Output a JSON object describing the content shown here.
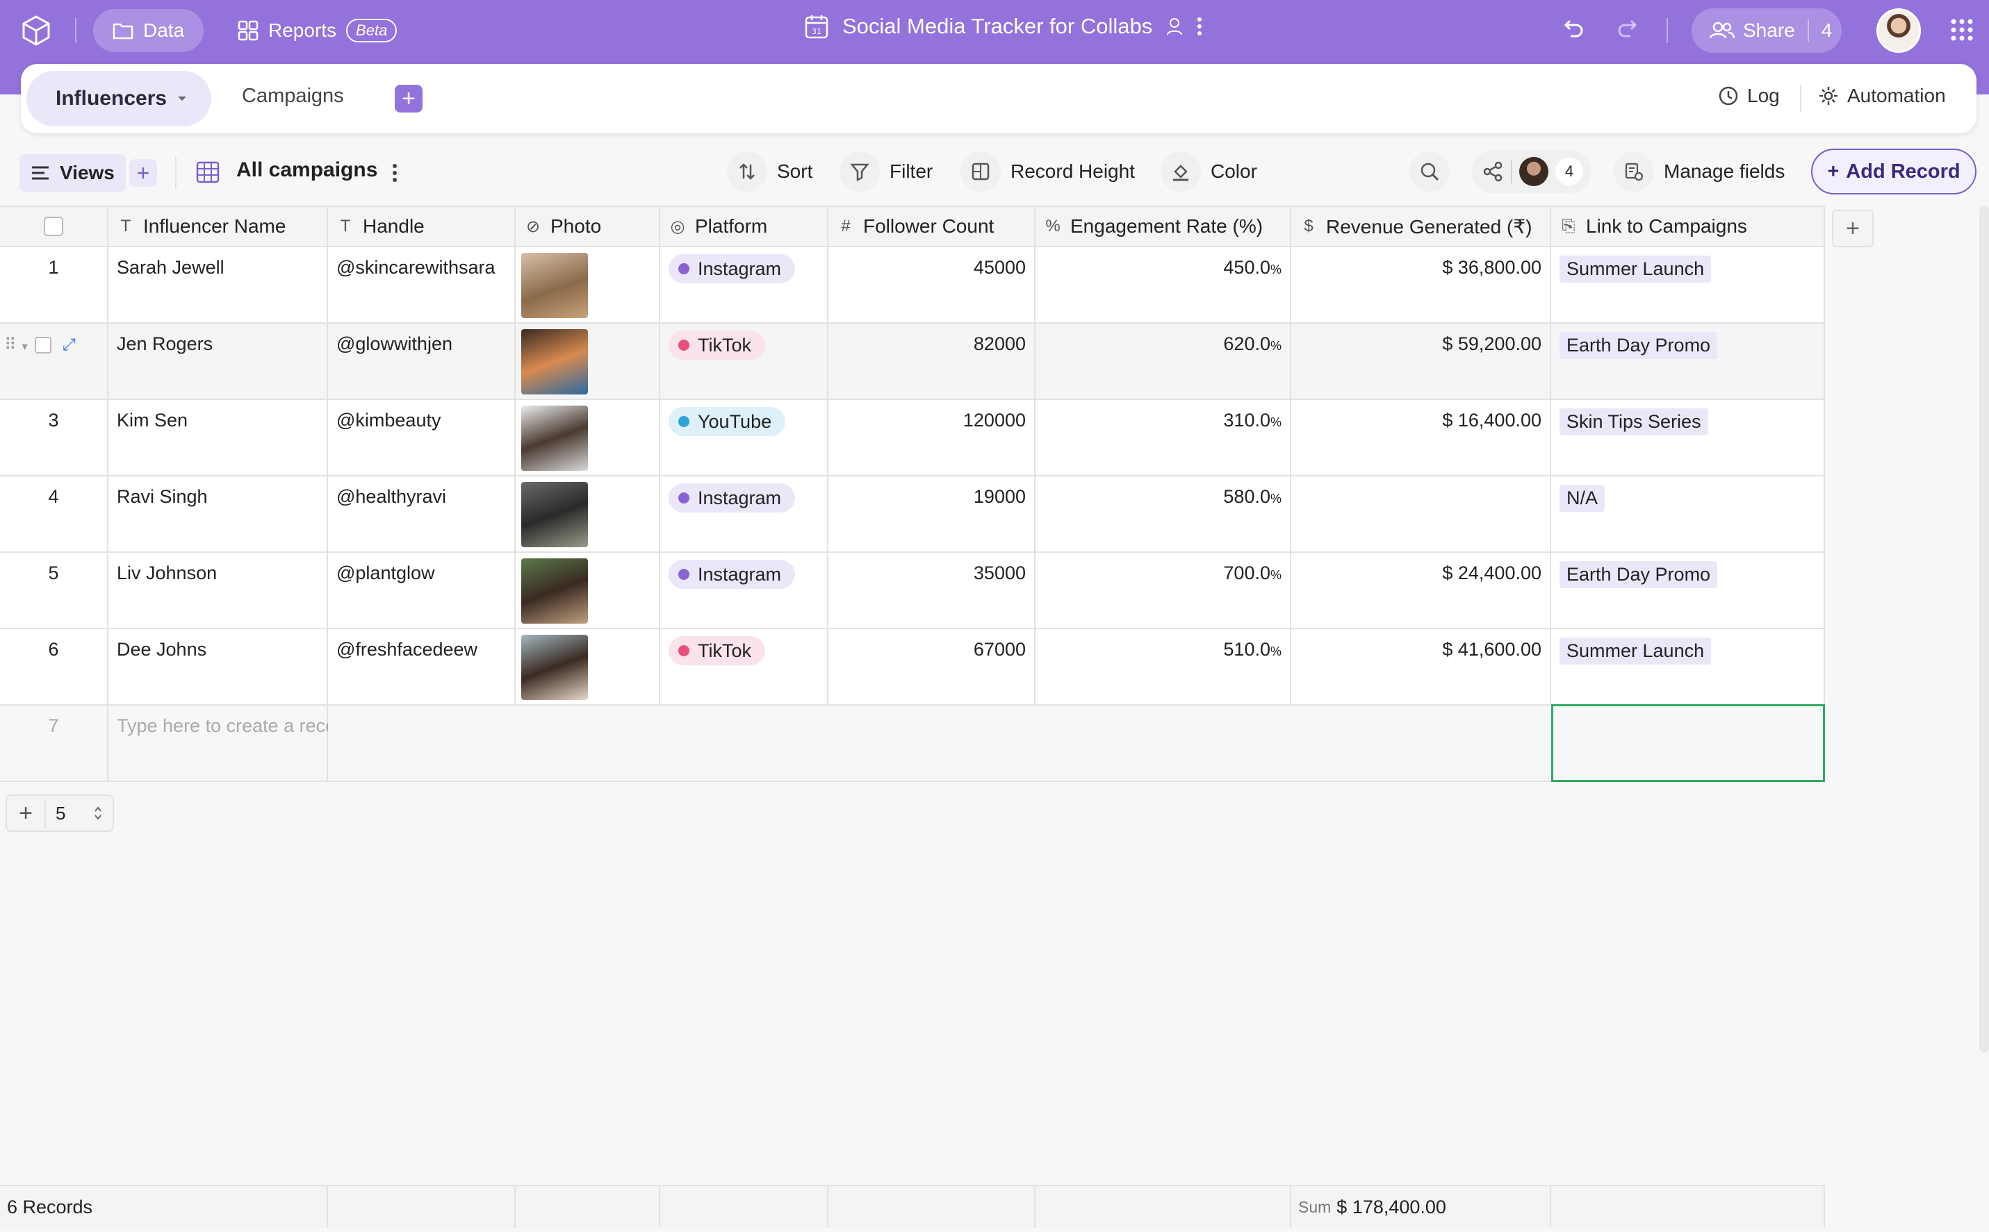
{
  "topbar": {
    "data_tab": "Data",
    "reports_tab": "Reports",
    "reports_badge": "Beta",
    "title": "Social Media Tracker for Collabs",
    "share_label": "Share",
    "share_count": "4"
  },
  "tabs": {
    "active": "Influencers",
    "other": "Campaigns",
    "log": "Log",
    "automation": "Automation"
  },
  "toolbar": {
    "views": "Views",
    "view_name": "All campaigns",
    "sort": "Sort",
    "filter": "Filter",
    "record_height": "Record Height",
    "color": "Color",
    "collaborators_count": "4",
    "manage_fields": "Manage fields",
    "add_record": "Add Record"
  },
  "columns": [
    {
      "label": "Influencer Name",
      "icon": "text-field-icon"
    },
    {
      "label": "Handle",
      "icon": "text-field-icon"
    },
    {
      "label": "Photo",
      "icon": "attachment-icon"
    },
    {
      "label": "Platform",
      "icon": "single-select-icon"
    },
    {
      "label": "Follower Count",
      "icon": "number-icon"
    },
    {
      "label": "Engagement Rate (%)",
      "icon": "percent-icon"
    },
    {
      "label": "Revenue Generated (₹)",
      "icon": "currency-icon"
    },
    {
      "label": "Link to Campaigns",
      "icon": "link-icon"
    }
  ],
  "rows": [
    {
      "idx": "1",
      "name": "Sarah Jewell",
      "handle": "@skincarewithsara",
      "platform": "Instagram",
      "followers": "45000",
      "engagement": "450.0",
      "revenue": "$ 36,800.00",
      "campaign": "Summer Launch"
    },
    {
      "idx": "2",
      "name": "Jen Rogers",
      "handle": "@glowwithjen",
      "platform": "TikTok",
      "followers": "82000",
      "engagement": "620.0",
      "revenue": "$ 59,200.00",
      "campaign": "Earth Day Promo"
    },
    {
      "idx": "3",
      "name": "Kim Sen",
      "handle": "@kimbeauty",
      "platform": "YouTube",
      "followers": "120000",
      "engagement": "310.0",
      "revenue": "$ 16,400.00",
      "campaign": "Skin Tips Series"
    },
    {
      "idx": "4",
      "name": "Ravi Singh",
      "handle": "@healthyravi",
      "platform": "Instagram",
      "followers": "19000",
      "engagement": "580.0",
      "revenue": "",
      "campaign": "N/A"
    },
    {
      "idx": "5",
      "name": "Liv Johnson",
      "handle": "@plantglow",
      "platform": "Instagram",
      "followers": "35000",
      "engagement": "700.0",
      "revenue": "$ 24,400.00",
      "campaign": "Earth Day Promo"
    },
    {
      "idx": "6",
      "name": "Dee Johns",
      "handle": "@freshfacedeew",
      "platform": "TikTok",
      "followers": "67000",
      "engagement": "510.0",
      "revenue": "$ 41,600.00",
      "campaign": "Summer Launch"
    }
  ],
  "percent_unit": "%",
  "new_row": {
    "idx": "7",
    "placeholder": "Type here to create a record"
  },
  "row_add_count": "5",
  "footer": {
    "records": "6 Records",
    "sum_label": "Sum",
    "sum_value": "$ 178,400.00"
  },
  "colors": {
    "accent": "#9372dc",
    "instagram_dot": "#8a63d2",
    "tiktok_dot": "#e8507a",
    "youtube_dot": "#2fa3d6",
    "selection": "#2eaa66"
  }
}
